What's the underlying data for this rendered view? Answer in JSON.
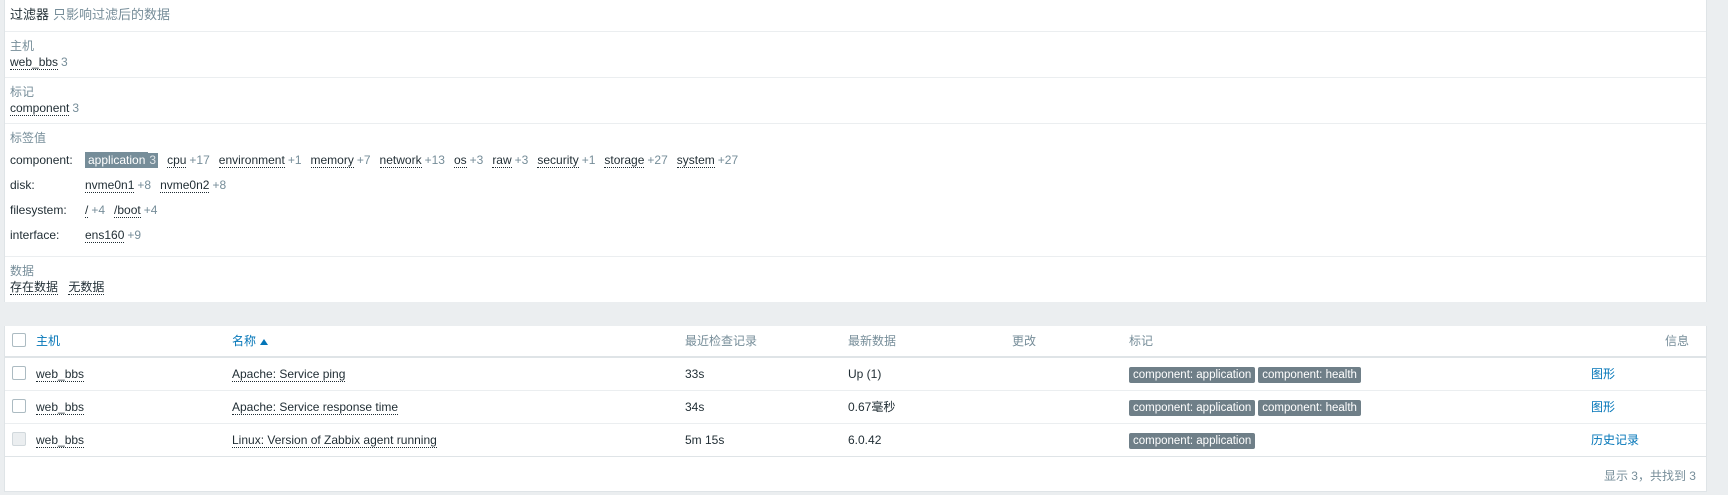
{
  "filter": {
    "title": "过滤器",
    "subtitle": "只影响过滤后的数据",
    "host_section": {
      "label": "主机",
      "items": [
        {
          "name": "web_bbs",
          "count": "3"
        }
      ]
    },
    "tag_section": {
      "label": "标记",
      "items": [
        {
          "name": "component",
          "count": "3"
        }
      ]
    },
    "tag_values": {
      "label": "标签值",
      "rows": [
        {
          "name": "component:",
          "items": [
            {
              "value": "application",
              "count": "3",
              "selected": true
            },
            {
              "value": "cpu",
              "count": "+17"
            },
            {
              "value": "environment",
              "count": "+1"
            },
            {
              "value": "memory",
              "count": "+7"
            },
            {
              "value": "network",
              "count": "+13"
            },
            {
              "value": "os",
              "count": "+3"
            },
            {
              "value": "raw",
              "count": "+3"
            },
            {
              "value": "security",
              "count": "+1"
            },
            {
              "value": "storage",
              "count": "+27"
            },
            {
              "value": "system",
              "count": "+27"
            }
          ]
        },
        {
          "name": "disk:",
          "items": [
            {
              "value": "nvme0n1",
              "count": "+8"
            },
            {
              "value": "nvme0n2",
              "count": "+8"
            }
          ]
        },
        {
          "name": "filesystem:",
          "items": [
            {
              "value": "/",
              "count": "+4"
            },
            {
              "value": "/boot",
              "count": "+4"
            }
          ]
        },
        {
          "name": "interface:",
          "items": [
            {
              "value": "ens160",
              "count": "+9"
            }
          ]
        }
      ]
    },
    "data_section": {
      "label": "数据",
      "items": [
        "存在数据",
        "无数据"
      ]
    }
  },
  "table": {
    "headers": {
      "host": "主机",
      "name": "名称",
      "last_check": "最近检查记录",
      "last_value": "最新数据",
      "change": "更改",
      "tags": "标记",
      "info": "信息"
    },
    "rows": [
      {
        "host": "web_bbs",
        "name": "Apache: Service ping",
        "last_check": "33s",
        "last_value": "Up (1)",
        "change": "",
        "tags": [
          "component: application",
          "component: health"
        ],
        "info": "图形",
        "checkbox_disabled": false
      },
      {
        "host": "web_bbs",
        "name": "Apache: Service response time",
        "last_check": "34s",
        "last_value": "0.67毫秒",
        "change": "",
        "tags": [
          "component: application",
          "component: health"
        ],
        "info": "图形",
        "checkbox_disabled": false
      },
      {
        "host": "web_bbs",
        "name": "Linux: Version of Zabbix agent running",
        "last_check": "5m 15s",
        "last_value": "6.0.42",
        "change": "",
        "tags": [
          "component: application"
        ],
        "info": "历史记录",
        "checkbox_disabled": true
      }
    ],
    "footer": "显示 3，共找到 3"
  }
}
